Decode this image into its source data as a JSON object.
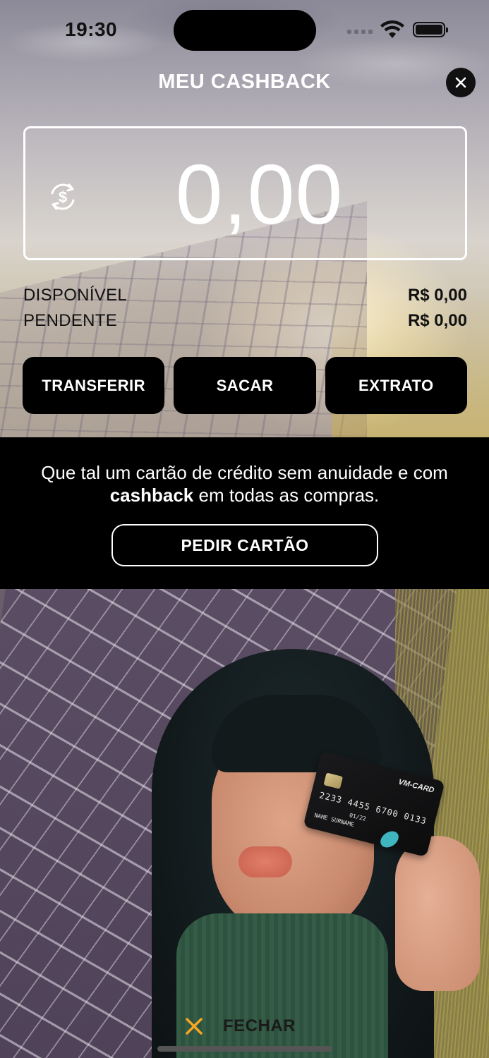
{
  "status_bar": {
    "time": "19:30"
  },
  "header": {
    "title": "MEU CASHBACK"
  },
  "balance": {
    "amount": "0,00"
  },
  "summary": {
    "available_label": "DISPONÍVEL",
    "available_value": "R$ 0,00",
    "pending_label": "PENDENTE",
    "pending_value": "R$ 0,00"
  },
  "actions": [
    {
      "label": "TRANSFERIR"
    },
    {
      "label": "SACAR"
    },
    {
      "label": "EXTRATO"
    }
  ],
  "promo": {
    "text_before": "Que tal um cartão de crédito sem anuidade e com",
    "text_bold": "cashback",
    "text_after": "em todas as compras.",
    "button_label": "PEDIR CARTÃO"
  },
  "card_image": {
    "brand": "VM-CARD",
    "number": "2233 4455 6700 0133",
    "expiry": "01/22",
    "holder": "NAME SURNAME"
  },
  "footer": {
    "close_label": "FECHAR"
  },
  "colors": {
    "accent_orange": "#f5a623",
    "button_bg": "#000000",
    "text_white": "#ffffff"
  }
}
